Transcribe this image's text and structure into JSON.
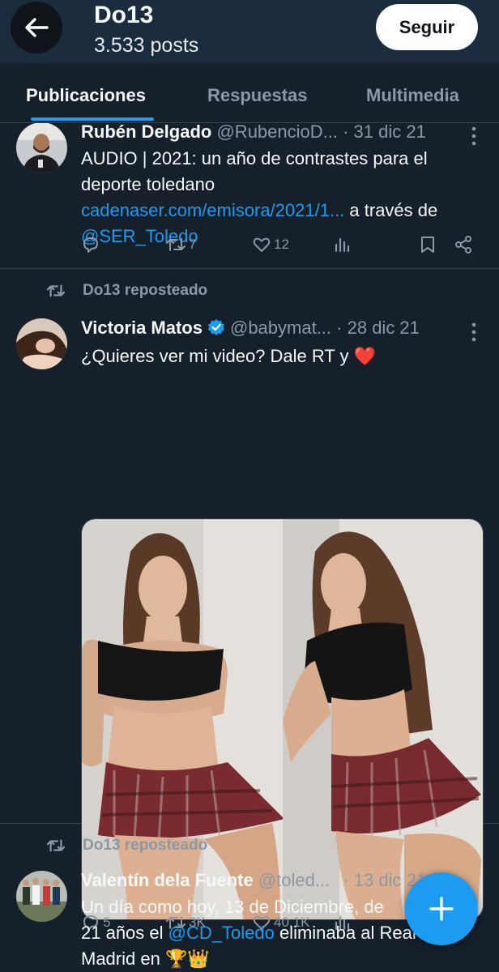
{
  "header": {
    "title": "Do13",
    "subtitle": "3.533 posts",
    "follow_label": "Seguir"
  },
  "tabs": [
    "Publicaciones",
    "Respuestas",
    "Multimedia"
  ],
  "colors": {
    "background": "#15202b",
    "accent": "#1d9bf0",
    "muted": "#8b98a5",
    "like": "#f91880"
  },
  "tweets": [
    {
      "name": "Rubén Delgado",
      "handle": "@RubencioD...",
      "date": "· 31 dic 21",
      "text_pre": "AUDIO | 2021: un año de contrastes para el deporte toledano ",
      "link": "cadenaser.com/emisora/2021/1...",
      "text_mid": " a través de ",
      "mention": "@SER_Toledo",
      "retweets": "7",
      "likes": "12"
    },
    {
      "repost_label": "Do13 reposteado",
      "name": "Victoria Matos",
      "handle": "@babymat...",
      "date": "· 28 dic 21",
      "text": "¿Quieres ver mi video? Dale RT y",
      "emoji": "❤️",
      "replies": "5",
      "retweets": "3K",
      "likes": "40,1K"
    },
    {
      "repost_label": "Do13 reposteado",
      "name": "Valentín dela Fuente",
      "handle": "@toled...",
      "date": "· 13 dic 21",
      "line1": "Un día como hoy, 13 de Diciembre, de",
      "line2_pre": "21 años el ",
      "mention": "@CD_Toledo",
      "line2_post": " eliminaba al Real",
      "line3": "Madrid en",
      "emojis": "🏆👑"
    }
  ]
}
